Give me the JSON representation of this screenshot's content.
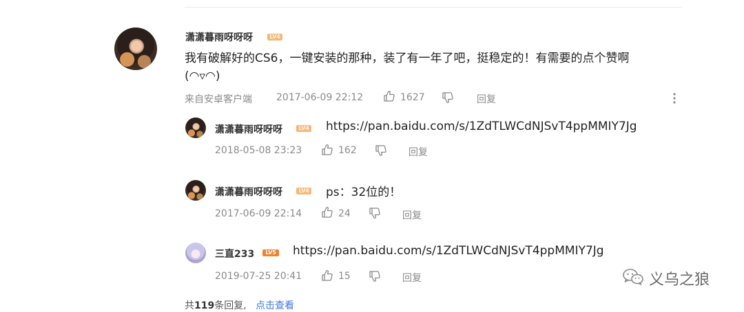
{
  "main_comment": {
    "username": "潇潇暮雨呀呀呀",
    "level": "LV4",
    "text_line1": "我有破解好的CS6，一键安装的那种，装了有一年了吧，挺稳定的！有需要的点个赞啊",
    "text_line2": "(◠▿◠)",
    "source": "来自安卓客户端",
    "timestamp": "2017-06-09 22:12",
    "likes": "1627",
    "reply_label": "回复"
  },
  "replies": [
    {
      "username": "潇潇暮雨呀呀呀",
      "level": "LV4",
      "text": "https://pan.baidu.com/s/1ZdTLWCdNJSvT4ppMMIY7Jg",
      "timestamp": "2018-05-08 23:23",
      "likes": "162",
      "reply_label": "回复"
    },
    {
      "username": "潇潇暮雨呀呀呀",
      "level": "LV4",
      "text": "ps：32位的！",
      "timestamp": "2017-06-09 22:14",
      "likes": "24",
      "reply_label": "回复"
    },
    {
      "username": "三直233",
      "level": "LV5",
      "text": "https://pan.baidu.com/s/1ZdTLWCdNJSvT4ppMMIY7Jg",
      "timestamp": "2019-07-25 20:41",
      "likes": "15",
      "reply_label": "回复"
    }
  ],
  "footer": {
    "prefix": "共",
    "count": "119",
    "suffix": "条回复,",
    "view_link": "点击查看"
  },
  "watermark": {
    "text": "义乌之狼",
    "icon": "wechat-icon"
  },
  "colors": {
    "link": "#3a7bd5",
    "meta": "#8a8a8a",
    "badge": "#f0822e"
  }
}
